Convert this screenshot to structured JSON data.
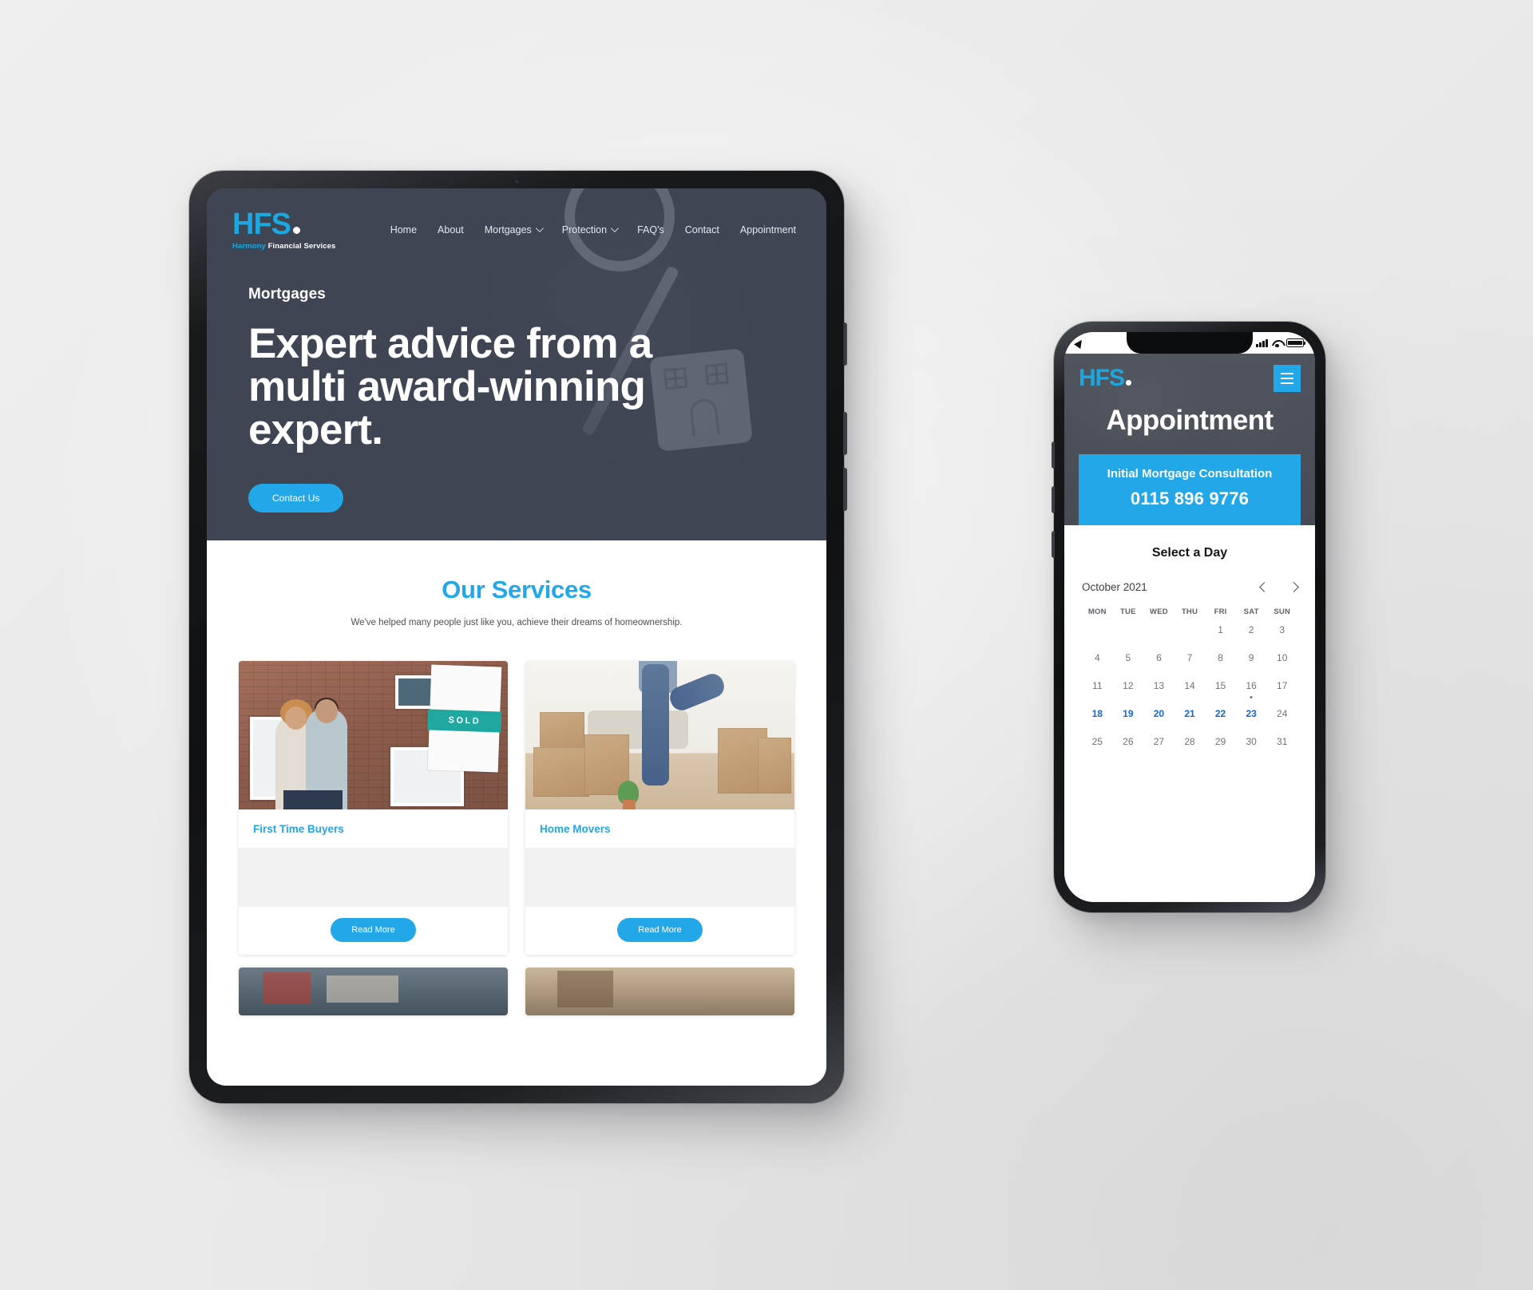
{
  "tablet": {
    "logo": {
      "mark": "HFS",
      "sub_brand": "Harmony",
      "sub_rest": "Financial Services"
    },
    "nav": [
      {
        "label": "Home",
        "has_caret": false
      },
      {
        "label": "About",
        "has_caret": false
      },
      {
        "label": "Mortgages",
        "has_caret": true
      },
      {
        "label": "Protection",
        "has_caret": true
      },
      {
        "label": "FAQ's",
        "has_caret": false
      },
      {
        "label": "Contact",
        "has_caret": false
      },
      {
        "label": "Appointment",
        "has_caret": false
      }
    ],
    "hero": {
      "eyebrow": "Mortgages",
      "title": "Expert advice from a multi award-winning expert.",
      "cta_label": "Contact Us"
    },
    "services": {
      "heading": "Our Services",
      "subheading": "We've helped many people just like you, achieve their dreams of homeownership.",
      "cards": [
        {
          "title": "First Time Buyers",
          "button_label": "Read More",
          "image_badge": "SOLD"
        },
        {
          "title": "Home Movers",
          "button_label": "Read More"
        }
      ]
    }
  },
  "phone": {
    "statusbar": {
      "location_icon": "location-arrow-icon",
      "signal_icon": "cellular-bars-icon",
      "wifi_icon": "wifi-icon",
      "battery_icon": "battery-icon"
    },
    "logo": {
      "mark": "HFS"
    },
    "menu_icon": "hamburger-menu-icon",
    "page_title": "Appointment",
    "consultation": {
      "label": "Initial Mortgage Consultation",
      "phone_number": "0115 896 9776"
    },
    "calendar": {
      "heading": "Select a Day",
      "month_label": "October 2021",
      "prev_icon": "chevron-left-icon",
      "next_icon": "chevron-right-icon",
      "day_headers": [
        "MON",
        "TUE",
        "WED",
        "THU",
        "FRI",
        "SAT",
        "SUN"
      ],
      "weeks": [
        [
          {
            "d": ""
          },
          {
            "d": ""
          },
          {
            "d": ""
          },
          {
            "d": ""
          },
          {
            "d": "1"
          },
          {
            "d": "2"
          },
          {
            "d": "3"
          }
        ],
        [
          {
            "d": "4"
          },
          {
            "d": "5"
          },
          {
            "d": "6"
          },
          {
            "d": "7"
          },
          {
            "d": "8"
          },
          {
            "d": "9"
          },
          {
            "d": "10"
          }
        ],
        [
          {
            "d": "11"
          },
          {
            "d": "12"
          },
          {
            "d": "13"
          },
          {
            "d": "14"
          },
          {
            "d": "15"
          },
          {
            "d": "16",
            "dot": true
          },
          {
            "d": "17"
          }
        ],
        [
          {
            "d": "18",
            "sel": true
          },
          {
            "d": "19",
            "sel": true
          },
          {
            "d": "20",
            "sel": true
          },
          {
            "d": "21",
            "sel": true
          },
          {
            "d": "22",
            "sel": true
          },
          {
            "d": "23",
            "sel": true
          },
          {
            "d": "24"
          }
        ],
        [
          {
            "d": "25"
          },
          {
            "d": "26"
          },
          {
            "d": "27"
          },
          {
            "d": "28"
          },
          {
            "d": "29"
          },
          {
            "d": "30"
          },
          {
            "d": "31"
          }
        ]
      ]
    }
  },
  "colors": {
    "brand_blue": "#22a7e8",
    "logo_blue": "#1ca7e0",
    "hero_navy": "#454c5c",
    "selected_day_text": "#1566d6",
    "selected_day_bg": "#deeaf9"
  }
}
